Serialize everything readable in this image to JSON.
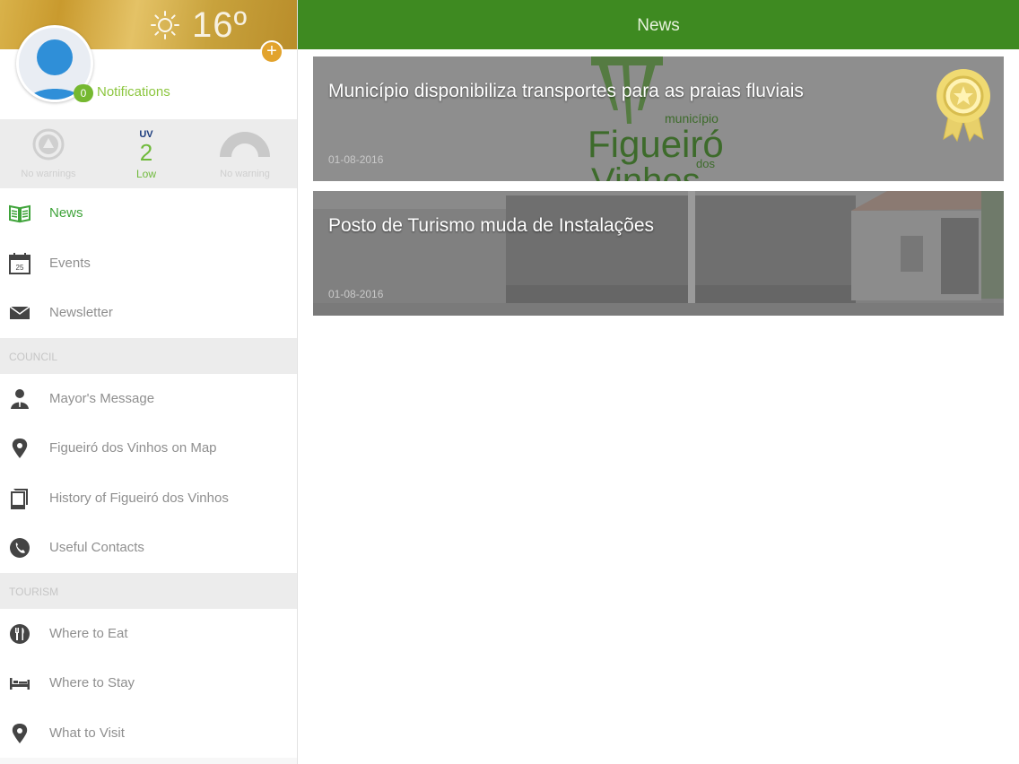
{
  "colors": {
    "brand_green": "#3e8a21",
    "accent_green": "#6fba3b",
    "add_button_orange": "#e2a32d",
    "sidebar_bg": "#f7f7f7",
    "section_bg": "#ececec"
  },
  "weather": {
    "icon": "sun-icon",
    "temperature": "16º"
  },
  "profile": {
    "avatar_icon": "user-avatar-icon",
    "add_button_icon": "plus-icon",
    "notification_count": "0",
    "notification_label": "Notifications"
  },
  "stats": {
    "left_icon": "warning-triangle-icon",
    "left_caption": "No warnings",
    "uv_title": "UV",
    "uv_value": "2",
    "uv_level": "Low",
    "right_icon": "gauge-icon",
    "right_caption": "No warning"
  },
  "menu": {
    "top_items": [
      {
        "label": "News",
        "icon": "newspaper-icon",
        "active": true
      },
      {
        "label": "Events",
        "icon": "calendar-icon",
        "active": false
      },
      {
        "label": "Newsletter",
        "icon": "envelope-icon",
        "active": false
      }
    ],
    "council_section": "COUNCIL",
    "council_items": [
      {
        "label": "Mayor's Message",
        "icon": "person-icon"
      },
      {
        "label": "Figueiró dos Vinhos on Map",
        "icon": "map-pin-icon"
      },
      {
        "label": "History of Figueiró dos Vinhos",
        "icon": "book-icon"
      },
      {
        "label": "Useful Contacts",
        "icon": "phone-icon"
      }
    ],
    "tourism_section": "TOURISM",
    "tourism_items": [
      {
        "label": "Where to Eat",
        "icon": "cutlery-icon"
      },
      {
        "label": "Where to Stay",
        "icon": "bed-icon"
      },
      {
        "label": "What to Visit",
        "icon": "map-pin-icon"
      }
    ]
  },
  "header": {
    "title": "News"
  },
  "news": [
    {
      "title": "Município disponibiliza transportes para as praias fluviais",
      "date": "01-08-2016",
      "badge_icon": "award-ribbon-icon",
      "logo_text_1": "município",
      "logo_text_2": "Figueiró",
      "logo_text_3": "dos",
      "logo_text_4": "Vinhos"
    },
    {
      "title": "Posto de Turismo muda de Instalações",
      "date": "01-08-2016"
    }
  ]
}
